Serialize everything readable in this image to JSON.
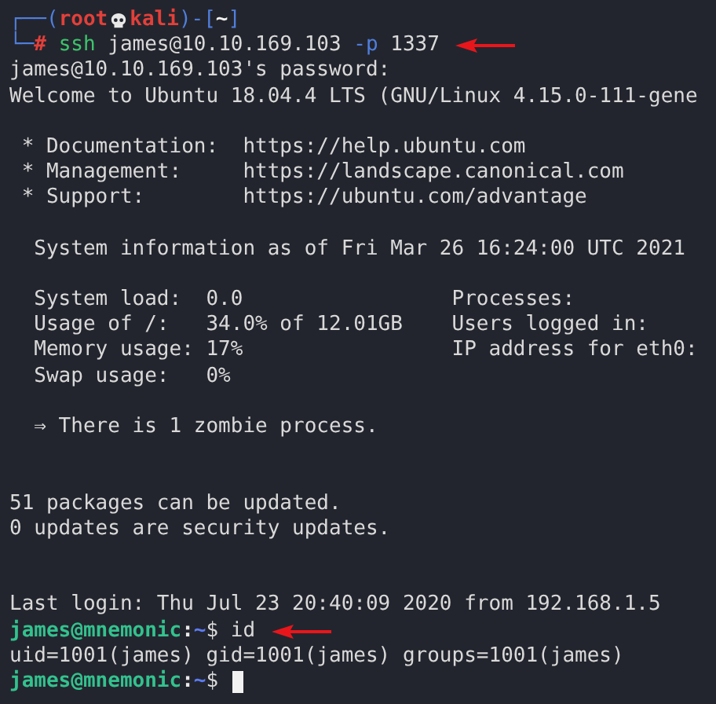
{
  "terminal": {
    "lines": [
      {
        "kind": "text",
        "segments": [
          {
            "text": "┌──(",
            "kind": "frame"
          },
          {
            "text": "root",
            "kind": "root"
          },
          {
            "kind": "skull"
          },
          {
            "text": "kali",
            "kind": "root"
          },
          {
            "text": ")-[",
            "kind": "frame"
          },
          {
            "text": "~",
            "kind": "dir"
          },
          {
            "text": "]",
            "kind": "frame"
          }
        ]
      },
      {
        "kind": "text",
        "arrow": true,
        "segments": [
          {
            "text": "└─",
            "kind": "frame"
          },
          {
            "text": "# ",
            "kind": "root"
          },
          {
            "text": "ssh",
            "kind": "command"
          },
          {
            "text": " james@10.10.169.103 ",
            "kind": "plain"
          },
          {
            "text": "-p",
            "kind": "flag"
          },
          {
            "text": " 1337",
            "kind": "plain"
          }
        ]
      },
      {
        "kind": "text",
        "segments": [
          {
            "text": "james@10.10.169.103's password:",
            "kind": "plain"
          }
        ]
      },
      {
        "kind": "text",
        "segments": [
          {
            "text": "Welcome to Ubuntu 18.04.4 LTS (GNU/Linux 4.15.0-111-gene",
            "kind": "plain"
          }
        ]
      },
      {
        "kind": "blank"
      },
      {
        "kind": "text",
        "segments": [
          {
            "text": " * Documentation:  https://help.ubuntu.com",
            "kind": "plain"
          }
        ]
      },
      {
        "kind": "text",
        "segments": [
          {
            "text": " * Management:     https://landscape.canonical.com",
            "kind": "plain"
          }
        ]
      },
      {
        "kind": "text",
        "segments": [
          {
            "text": " * Support:        https://ubuntu.com/advantage",
            "kind": "plain"
          }
        ]
      },
      {
        "kind": "blank"
      },
      {
        "kind": "text",
        "segments": [
          {
            "text": "  System information as of Fri Mar 26 16:24:00 UTC 2021",
            "kind": "plain"
          }
        ]
      },
      {
        "kind": "blank"
      },
      {
        "kind": "text",
        "segments": [
          {
            "text": "  System load:  0.0                 Processes:",
            "kind": "plain"
          }
        ]
      },
      {
        "kind": "text",
        "segments": [
          {
            "text": "  Usage of /:   34.0% of 12.01GB    Users logged in:",
            "kind": "plain"
          }
        ]
      },
      {
        "kind": "text",
        "segments": [
          {
            "text": "  Memory usage: 17%                 IP address for eth0:",
            "kind": "plain"
          }
        ]
      },
      {
        "kind": "text",
        "segments": [
          {
            "text": "  Swap usage:   0%",
            "kind": "plain"
          }
        ]
      },
      {
        "kind": "blank"
      },
      {
        "kind": "text",
        "segments": [
          {
            "text": "  ⇒ There is 1 zombie process.",
            "kind": "plain"
          }
        ]
      },
      {
        "kind": "blank"
      },
      {
        "kind": "blank"
      },
      {
        "kind": "text",
        "segments": [
          {
            "text": "51 packages can be updated.",
            "kind": "plain"
          }
        ]
      },
      {
        "kind": "text",
        "segments": [
          {
            "text": "0 updates are security updates.",
            "kind": "plain"
          }
        ]
      },
      {
        "kind": "blank"
      },
      {
        "kind": "blank"
      },
      {
        "kind": "text",
        "segments": [
          {
            "text": "Last login: Thu Jul 23 20:40:09 2020 from 192.168.1.5",
            "kind": "plain"
          }
        ]
      },
      {
        "kind": "text",
        "arrow": true,
        "segments": [
          {
            "text": "james@mnemonic",
            "kind": "user"
          },
          {
            "text": ":",
            "kind": "punct"
          },
          {
            "text": "~",
            "kind": "path"
          },
          {
            "text": "$ id",
            "kind": "plain"
          }
        ]
      },
      {
        "kind": "text",
        "segments": [
          {
            "text": "uid=1001(james) gid=1001(james) groups=1001(james)",
            "kind": "plain"
          }
        ]
      },
      {
        "kind": "text",
        "cursor": true,
        "segments": [
          {
            "text": "james@mnemonic",
            "kind": "user"
          },
          {
            "text": ":",
            "kind": "punct"
          },
          {
            "text": "~",
            "kind": "path"
          },
          {
            "text": "$ ",
            "kind": "plain"
          }
        ]
      }
    ]
  }
}
